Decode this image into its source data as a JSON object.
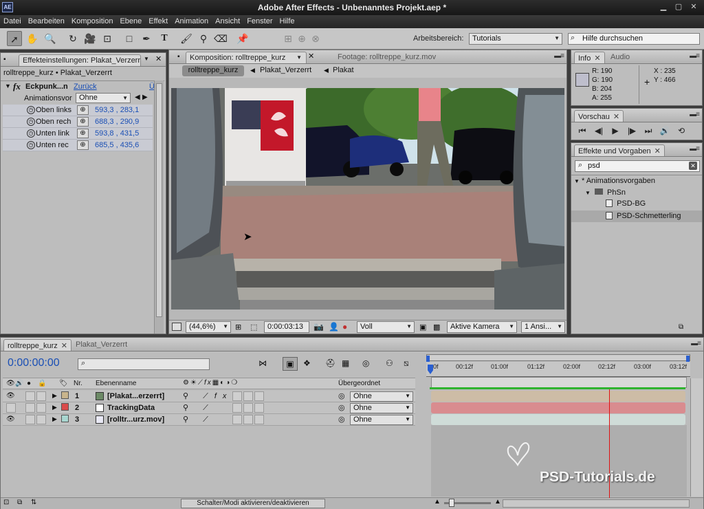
{
  "window": {
    "title": "Adobe After Effects - Unbenanntes Projekt.aep *",
    "logo": "AE"
  },
  "menu": [
    "Datei",
    "Bearbeiten",
    "Komposition",
    "Ebene",
    "Effekt",
    "Animation",
    "Ansicht",
    "Fenster",
    "Hilfe"
  ],
  "toolbar": {
    "workspace_label": "Arbeitsbereich:",
    "workspace_value": "Tutorials",
    "help_placeholder": "Hilfe durchsuchen"
  },
  "effects_panel": {
    "tab": "Effekteinstellungen: Plakat_Verzerrt",
    "breadcrumb": "rolltreppe_kurz • Plakat_Verzerrt",
    "effect_name": "Eckpunk...n",
    "reset": "Zurück",
    "about": "Ü",
    "anim_label": "Animationsvor",
    "anim_value": "Ohne",
    "params": [
      {
        "name": "Oben links",
        "value": "593,3 , 283,1"
      },
      {
        "name": "Oben rech",
        "value": "688,3 , 290,9"
      },
      {
        "name": "Unten link",
        "value": "593,8 , 431,5"
      },
      {
        "name": "Unten rec",
        "value": "685,5 , 435,6"
      }
    ]
  },
  "comp_panel": {
    "tab_comp": "Komposition: rolltreppe_kurz",
    "tab_footage": "Footage: rolltreppe_kurz.mov",
    "crumbs": [
      "rolltreppe_kurz",
      "Plakat_Verzerrt",
      "Plakat"
    ],
    "zoom": "(44,6%)",
    "timecode": "0:00:03:13",
    "resolution": "Voll",
    "camera": "Aktive Kamera",
    "views": "1 Ansi..."
  },
  "info_panel": {
    "tab_info": "Info",
    "tab_audio": "Audio",
    "r": "R:  190",
    "g": "G:  190",
    "b": "B:  204",
    "a": "A:  255",
    "x": "X : 235",
    "y": "Y : 466",
    "swatch_color": "#bebecc"
  },
  "preview_panel": {
    "tab": "Vorschau"
  },
  "effects_presets": {
    "tab": "Effekte und Vorgaben",
    "search": "psd",
    "items": [
      {
        "label": "* Animationsvorgaben",
        "indent": 0
      },
      {
        "label": "PhSn",
        "indent": 1
      },
      {
        "label": "PSD-BG",
        "indent": 2
      },
      {
        "label": "PSD-Schmetterling",
        "indent": 2
      }
    ]
  },
  "timeline": {
    "tab": "rolltreppe_kurz",
    "tab2": "Plakat_Verzerrt",
    "current_time": "0:00:00:00",
    "col_nr": "Nr.",
    "col_name": "Ebenenname",
    "col_parent": "Übergeordnet",
    "ticks": [
      "0f",
      "00:12f",
      "01:00f",
      "01:12f",
      "02:00f",
      "02:12f",
      "03:00f",
      "03:12f"
    ],
    "layers": [
      {
        "nr": "1",
        "name": "[Plakat...erzerrt]",
        "parent": "Ohne",
        "color": "#c8b48c",
        "bar": "#cdbca6"
      },
      {
        "nr": "2",
        "name": "TrackingData",
        "parent": "Ohne",
        "color": "#d94b4b",
        "bar": "#d98c8f"
      },
      {
        "nr": "3",
        "name": "[rolltr...urz.mov]",
        "parent": "Ohne",
        "color": "#a8d6d0",
        "bar": "#cfdcd8"
      }
    ],
    "toggle_label": "Schalter/Modi aktivieren/deaktivieren",
    "watermark": "PSD-Tutorials.de"
  },
  "colors": {
    "accent_blue": "#1a4fb5",
    "playhead": "#e01010",
    "work_area": "#2fb42f"
  }
}
